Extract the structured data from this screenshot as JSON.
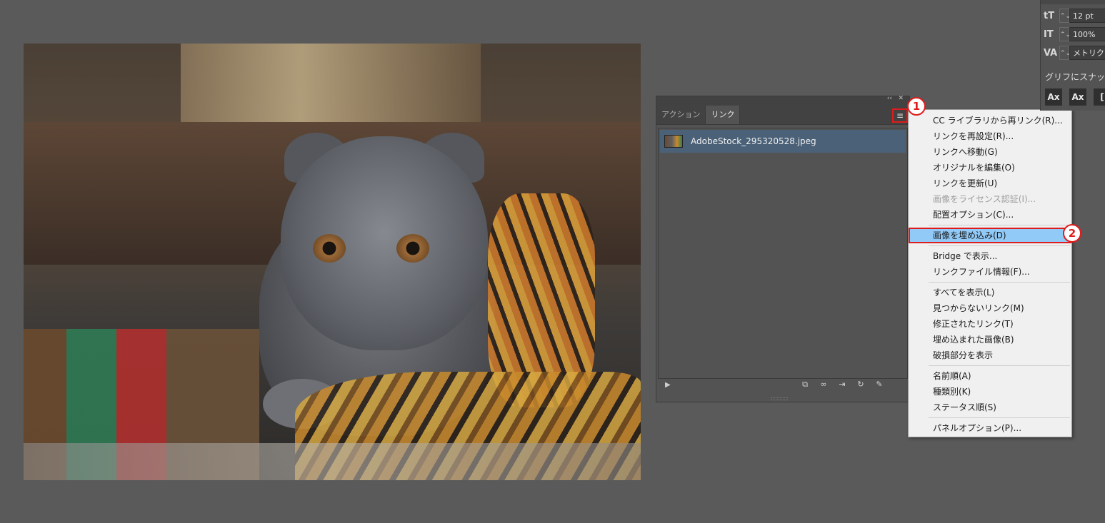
{
  "canvas": {
    "image_alt_icon": "photo"
  },
  "links_panel": {
    "tabs": [
      {
        "label": "アクション"
      },
      {
        "label": "リンク"
      }
    ],
    "collapse_glyph": "‹‹",
    "close_glyph": "✕",
    "menu_glyph": "≡",
    "items": [
      {
        "filename": "AdobeStock_295320528.jpeg"
      }
    ],
    "footer_icons": [
      "relink-cc-icon",
      "relink-icon",
      "goto-link-icon",
      "update-link-icon",
      "edit-original-icon"
    ]
  },
  "context_menu": {
    "groups": [
      [
        "CC ライブラリから再リンク(R)...",
        "リンクを再設定(R)...",
        "リンクへ移動(G)",
        "オリジナルを編集(O)",
        "リンクを更新(U)",
        "画像をライセンス認証(I)...",
        "配置オプション(C)..."
      ],
      [
        "画像を埋め込み(D)"
      ],
      [
        "Bridge で表示...",
        "リンクファイル情報(F)..."
      ],
      [
        "すべてを表示(L)",
        "見つからないリンク(M)",
        "修正されたリンク(T)",
        "埋め込まれた画像(B)",
        "破損部分を表示"
      ],
      [
        "名前順(A)",
        "種類別(K)",
        "ステータス順(S)"
      ],
      [
        "パネルオプション(P)..."
      ]
    ],
    "disabled": [
      "画像をライセンス認証(I)..."
    ],
    "highlighted": "画像を埋め込み(D)"
  },
  "annotations": {
    "badge1": "1",
    "badge2": "2"
  },
  "character_panel": {
    "rows": [
      {
        "icon": "tT",
        "value": "12 pt"
      },
      {
        "icon": "IT",
        "value": "100%"
      },
      {
        "icon": "VA",
        "value": "メトリク"
      }
    ],
    "glyph_snap_label": "グリフにスナッ",
    "glyph_buttons": [
      "Ax",
      "Ax",
      "["
    ]
  },
  "colors": {
    "highlight": "#91c9f7",
    "annotation": "#e01b1b",
    "selected_row": "#4a6178"
  }
}
